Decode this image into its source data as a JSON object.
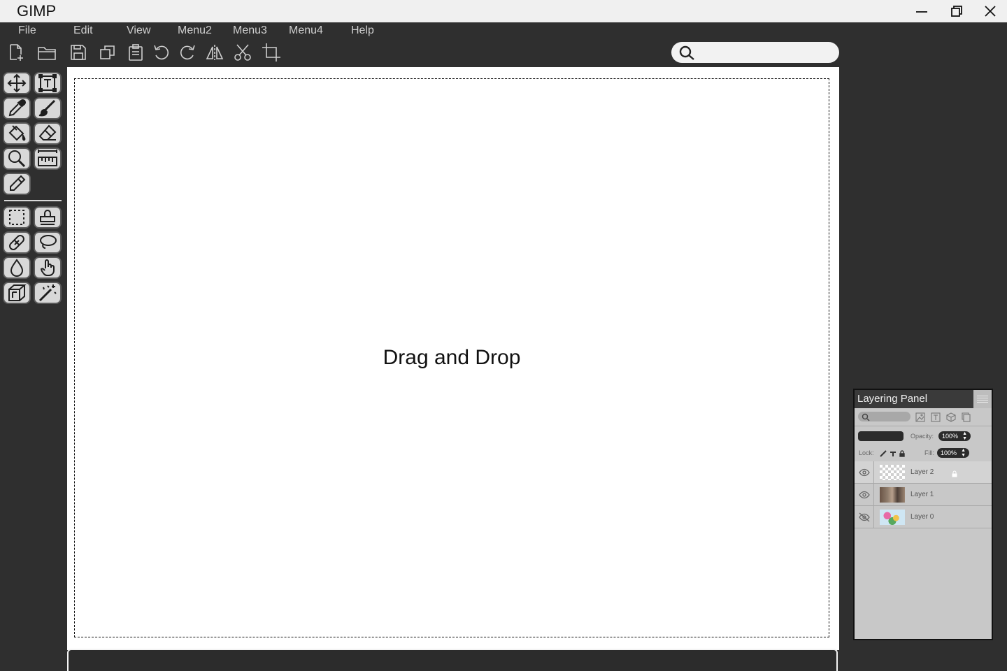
{
  "app": {
    "title": "GIMP"
  },
  "window_controls": [
    {
      "name": "minimize-icon"
    },
    {
      "name": "maximize-icon"
    },
    {
      "name": "close-icon"
    }
  ],
  "menubar": {
    "items": [
      "File",
      "Edit",
      "View",
      "Menu2",
      "Menu3",
      "Menu4",
      "Help"
    ]
  },
  "toolbar": {
    "buttons": [
      "new-file-icon",
      "open-folder-icon",
      "save-icon",
      "duplicate-icon",
      "clipboard-icon",
      "undo-icon",
      "redo-icon",
      "flip-icon",
      "cut-icon",
      "crop-icon"
    ],
    "search": {
      "placeholder": "",
      "value": ""
    }
  },
  "tools": {
    "upper": [
      "move-icon",
      "text-icon",
      "eyedropper-icon",
      "brush-icon",
      "bucket-icon",
      "eraser-icon",
      "zoom-icon",
      "ruler-icon",
      "pencil-icon"
    ],
    "lower": [
      "rect-select-icon",
      "stamp-icon",
      "heal-icon",
      "lasso-icon",
      "blur-drop-icon",
      "smudge-icon",
      "perspective-icon",
      "magic-wand-icon"
    ]
  },
  "canvas": {
    "drop_text": "Drag and Drop"
  },
  "layers_panel": {
    "title": "Layering Panel",
    "opacity_label": "Opacity:",
    "opacity_value": "100%",
    "fill_label": "Fill:",
    "fill_value": "100%",
    "lock_label": "Lock:",
    "layers": [
      {
        "name": "Layer 2",
        "visible": true,
        "locked": true,
        "selected": true,
        "thumbnail": "transparent"
      },
      {
        "name": "Layer 1",
        "visible": true,
        "locked": false,
        "selected": false,
        "thumbnail": "photo"
      },
      {
        "name": "Layer 0",
        "visible": false,
        "locked": false,
        "selected": false,
        "thumbnail": "flowers"
      }
    ]
  },
  "colors": {
    "chrome_dark": "#2f2f2f",
    "titlebar": "#f0f0f0",
    "menu_text": "#cfcfcf",
    "tool_bg": "#d8d8d8",
    "panel_bg": "#c8c8c8",
    "canvas": "#ffffff"
  }
}
